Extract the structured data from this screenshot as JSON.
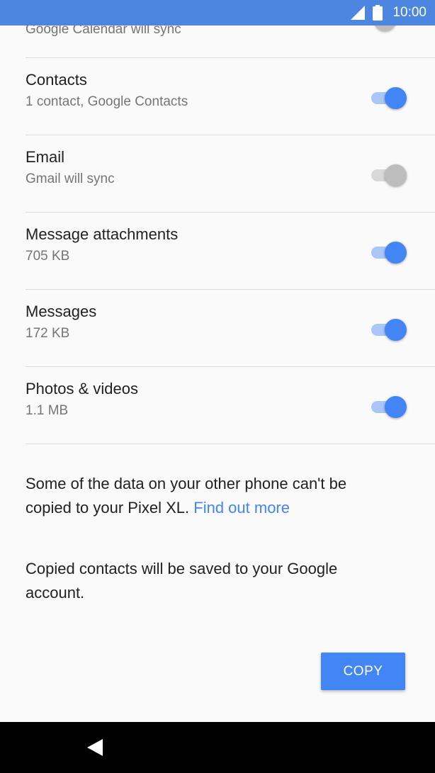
{
  "status_bar": {
    "time": "10:00",
    "icons": [
      "signal-icon",
      "battery-icon"
    ],
    "color": "#4c86e0"
  },
  "items": [
    {
      "title": "",
      "subtitle": "Google Calendar will sync",
      "enabled": false
    },
    {
      "title": "Contacts",
      "subtitle": "1 contact, Google Contacts",
      "enabled": true
    },
    {
      "title": "Email",
      "subtitle": "Gmail will sync",
      "enabled": false
    },
    {
      "title": "Message attachments",
      "subtitle": "705 KB",
      "enabled": true
    },
    {
      "title": "Messages",
      "subtitle": "172 KB",
      "enabled": true
    },
    {
      "title": "Photos & videos",
      "subtitle": "1.1 MB",
      "enabled": true
    }
  ],
  "info": {
    "copy_notice": "Some of the data on your other phone can't be copied to your Pixel XL.",
    "find_out_more": "Find out more",
    "contacts_notice": "Copied contacts will be saved to your Google account."
  },
  "actions": {
    "copy_label": "COPY"
  },
  "navigation": {
    "back_icon": "back-icon"
  },
  "colors": {
    "accent": "#4285f4",
    "toggle_on_track": "#a9c6f7",
    "toggle_off": "#bdbdbd"
  }
}
